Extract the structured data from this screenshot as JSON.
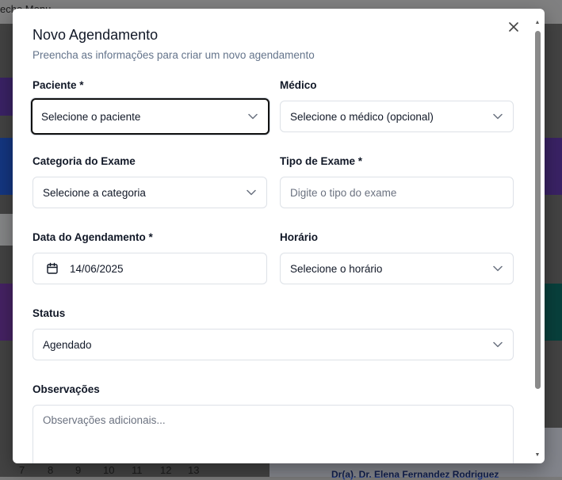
{
  "background": {
    "topbar_text": "echo  Menu",
    "calendar_numbers": [
      "7",
      "8",
      "9",
      "10",
      "11",
      "12",
      "13"
    ],
    "doctor_link": "Dr(a). Dr. Elena Fernandez Rodriguez"
  },
  "dialog": {
    "title": "Novo Agendamento",
    "subtitle": "Preencha as informações para criar um novo agendamento",
    "close_icon": "close-icon"
  },
  "form": {
    "paciente": {
      "label": "Paciente *",
      "value": "Selecione o paciente"
    },
    "medico": {
      "label": "Médico",
      "value": "Selecione o médico (opcional)"
    },
    "categoria": {
      "label": "Categoria do Exame",
      "value": "Selecione a categoria"
    },
    "tipo": {
      "label": "Tipo de Exame *",
      "placeholder": "Digite o tipo do exame"
    },
    "data": {
      "label": "Data do Agendamento *",
      "value": "14/06/2025",
      "icon": "calendar-icon"
    },
    "horario": {
      "label": "Horário",
      "value": "Selecione o horário"
    },
    "status": {
      "label": "Status",
      "value": "Agendado"
    },
    "observacoes": {
      "label": "Observações",
      "placeholder": "Observações adicionais..."
    }
  },
  "colors": {
    "focus_border": "#111111",
    "label": "#111827",
    "muted": "#64748b",
    "border": "#dde1e7"
  }
}
